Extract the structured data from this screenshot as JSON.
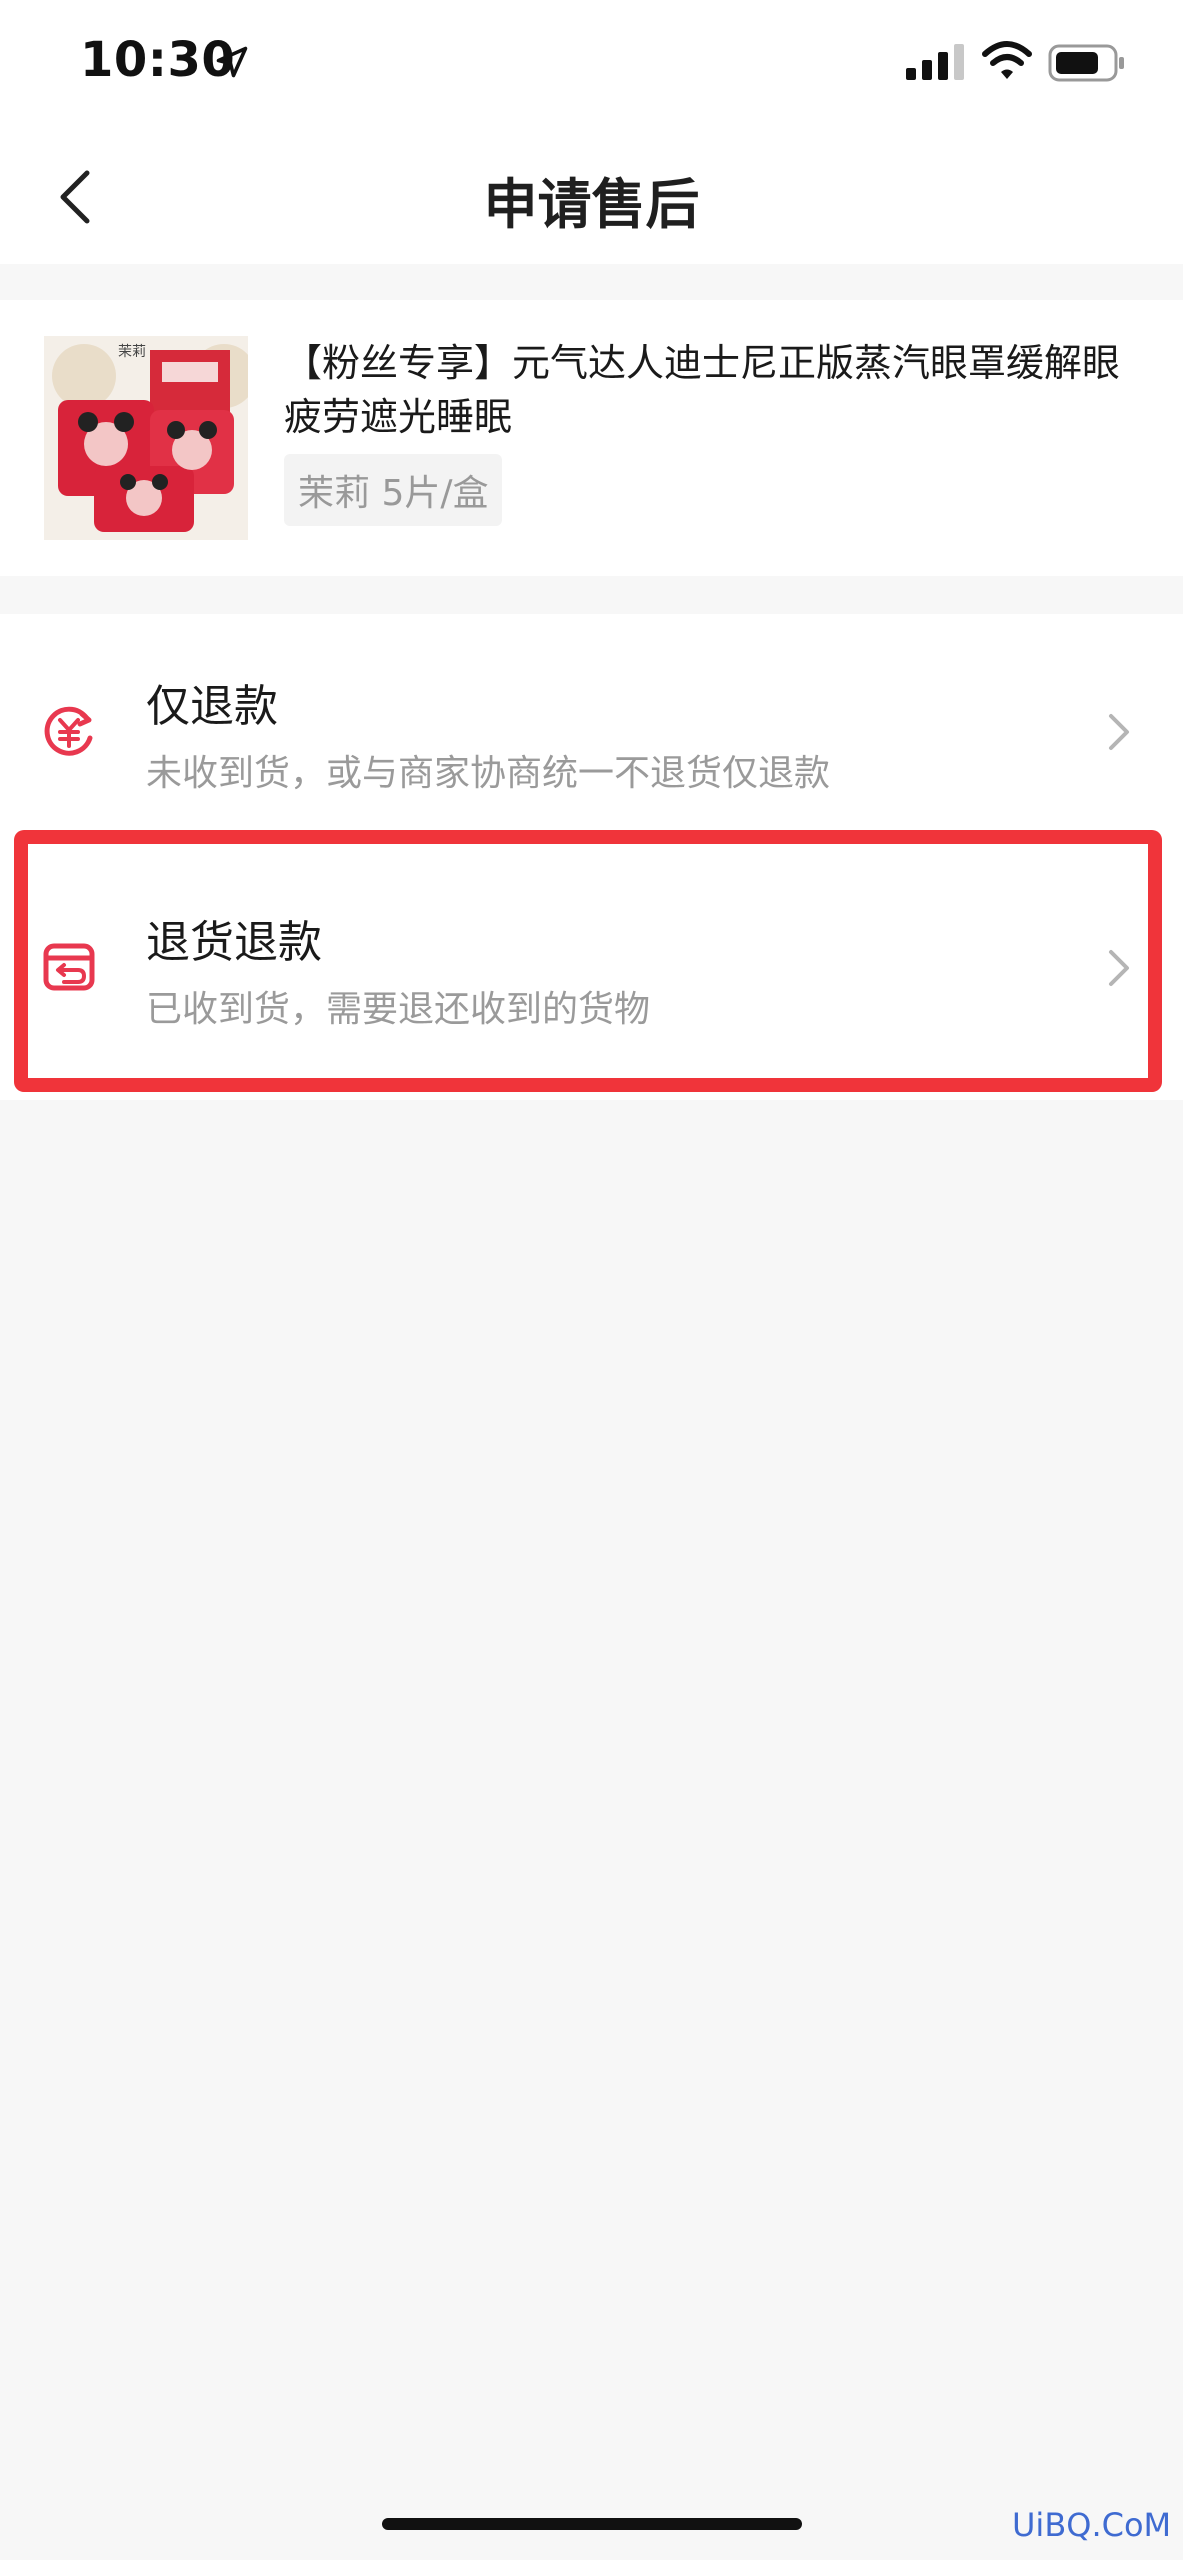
{
  "status_bar": {
    "time": "10:30"
  },
  "nav": {
    "title": "申请售后"
  },
  "product": {
    "title": "【粉丝专享】元气达人迪士尼正版蒸汽眼罩缓解眼疲劳遮光睡眠",
    "sku": "茉莉 5片/盒",
    "thumb_label": "茉莉"
  },
  "options": [
    {
      "title": "仅退款",
      "desc": "未收到货，或与商家协商统一不退货仅退款",
      "icon": "yuan-refund-icon"
    },
    {
      "title": "退货退款",
      "desc": "已收到货，需要退还收到的货物",
      "icon": "return-box-icon"
    }
  ],
  "colors": {
    "accent": "#e8384f",
    "highlight": "#f0343a"
  },
  "watermark": "UiBQ.CoM"
}
